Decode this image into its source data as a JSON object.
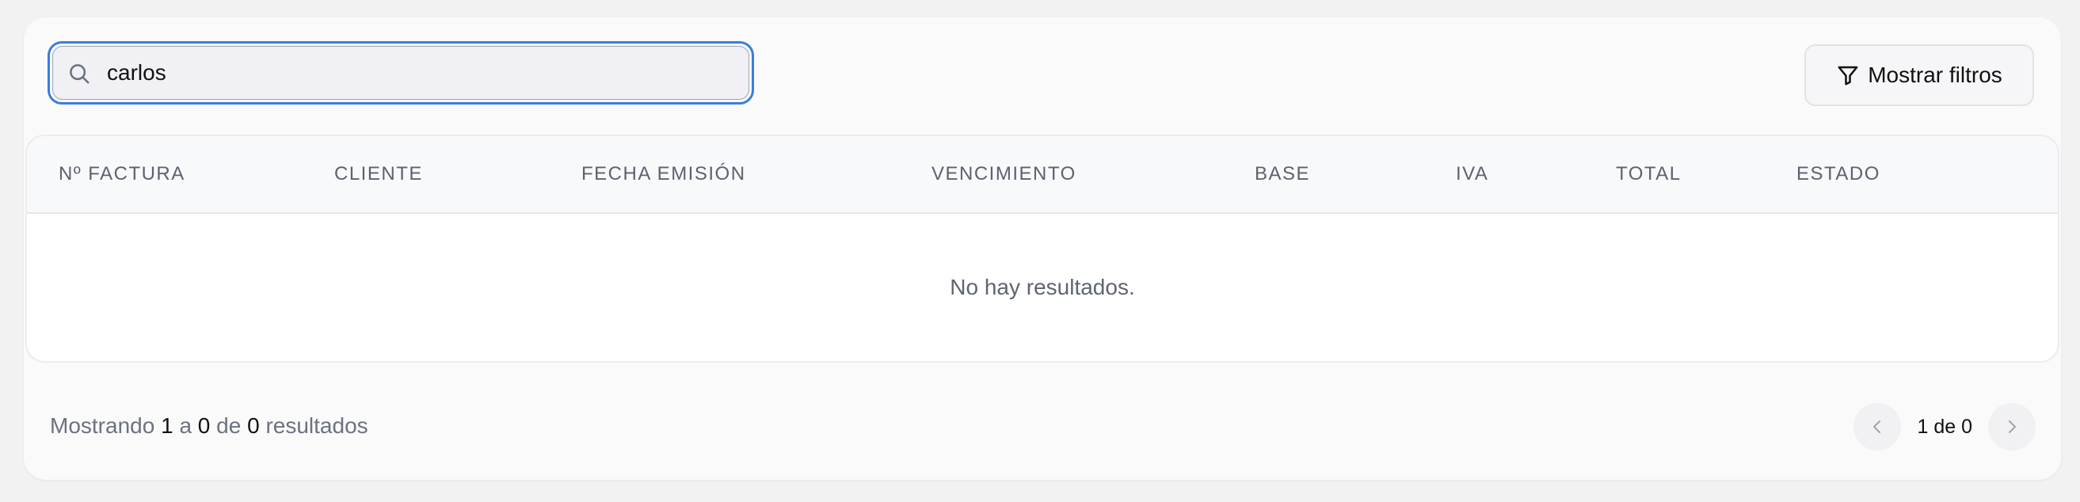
{
  "search": {
    "value": "carlos",
    "icon": "search-icon"
  },
  "toolbar": {
    "filters_label": "Mostrar filtros",
    "filters_icon": "filter-icon"
  },
  "table": {
    "columns": [
      "Nº FACTURA",
      "CLIENTE",
      "FECHA EMISIÓN",
      "VENCIMIENTO",
      "BASE",
      "IVA",
      "TOTAL",
      "ESTADO"
    ],
    "empty_message": "No hay resultados."
  },
  "footer": {
    "prefix": "Mostrando",
    "from": "1",
    "sep1": "a",
    "to": "0",
    "sep2": "de",
    "total": "0",
    "suffix": "resultados"
  },
  "pagination": {
    "label": "1 de 0",
    "prev_icon": "chevron-left-icon",
    "next_icon": "chevron-right-icon"
  },
  "colors": {
    "focus_ring": "#3b7ddd",
    "card_bg": "#fafafa",
    "page_bg": "#f2f2f3"
  }
}
